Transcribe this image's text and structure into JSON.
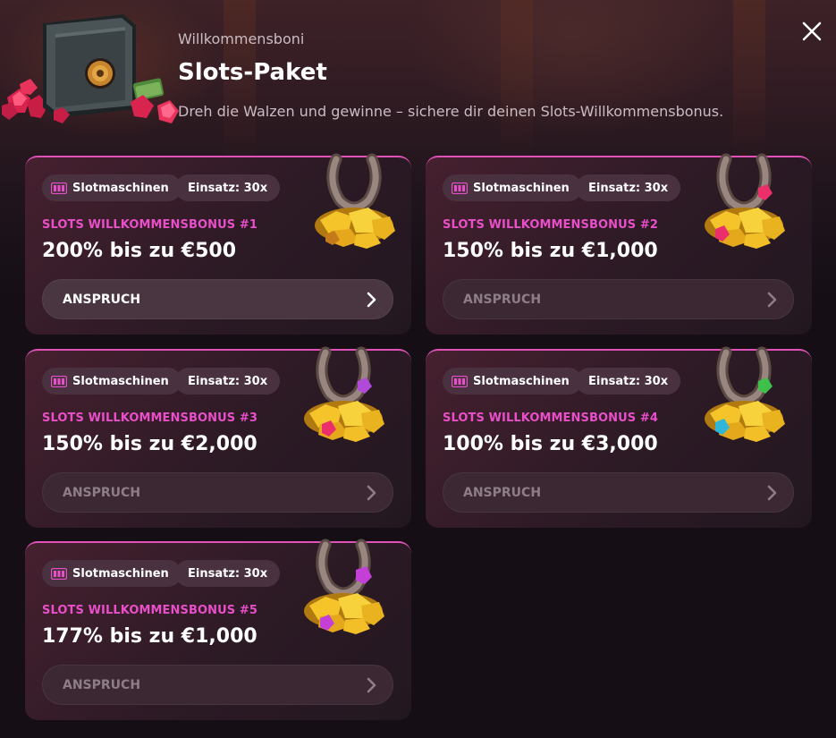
{
  "header": {
    "subtitle": "Willkommensboni",
    "title": "Slots-Paket",
    "description": "Dreh die Walzen und gewinne – sichere dir deinen Slots-Willkommensbonus.",
    "close_icon": "close-icon"
  },
  "colors": {
    "accent_pink": "#e84fc8",
    "card_border": "#e052b7",
    "background": "#150f15",
    "tag_background": "#4a3140"
  },
  "cards": [
    {
      "tag_category": "Slotmaschinen",
      "tag_wager": "Einsatz: 30x",
      "label": "SLOTS WILLKOMMENSBONUS #1",
      "amount": "200% bis zu €500",
      "claim_label": "ANSPRUCH",
      "claim_state": "active",
      "gem_color": "none"
    },
    {
      "tag_category": "Slotmaschinen",
      "tag_wager": "Einsatz: 30x",
      "label": "SLOTS WILLKOMMENSBONUS #2",
      "amount": "150% bis zu €1,000",
      "claim_label": "ANSPRUCH",
      "claim_state": "disabled",
      "gem_color": "#ea2f6a"
    },
    {
      "tag_category": "Slotmaschinen",
      "tag_wager": "Einsatz: 30x",
      "label": "SLOTS WILLKOMMENSBONUS #3",
      "amount": "150% bis zu €2,000",
      "claim_label": "ANSPRUCH",
      "claim_state": "disabled",
      "gem_color": "#b14ad8"
    },
    {
      "tag_category": "Slotmaschinen",
      "tag_wager": "Einsatz: 30x",
      "label": "SLOTS WILLKOMMENSBONUS #4",
      "amount": "100% bis zu €3,000",
      "claim_label": "ANSPRUCH",
      "claim_state": "disabled",
      "gem_color": "#3ec04a"
    },
    {
      "tag_category": "Slotmaschinen",
      "tag_wager": "Einsatz: 30x",
      "label": "SLOTS WILLKOMMENSBONUS #5",
      "amount": "177% bis zu €1,000",
      "claim_label": "ANSPRUCH",
      "claim_state": "disabled",
      "gem_color": "#c43fd6"
    }
  ]
}
